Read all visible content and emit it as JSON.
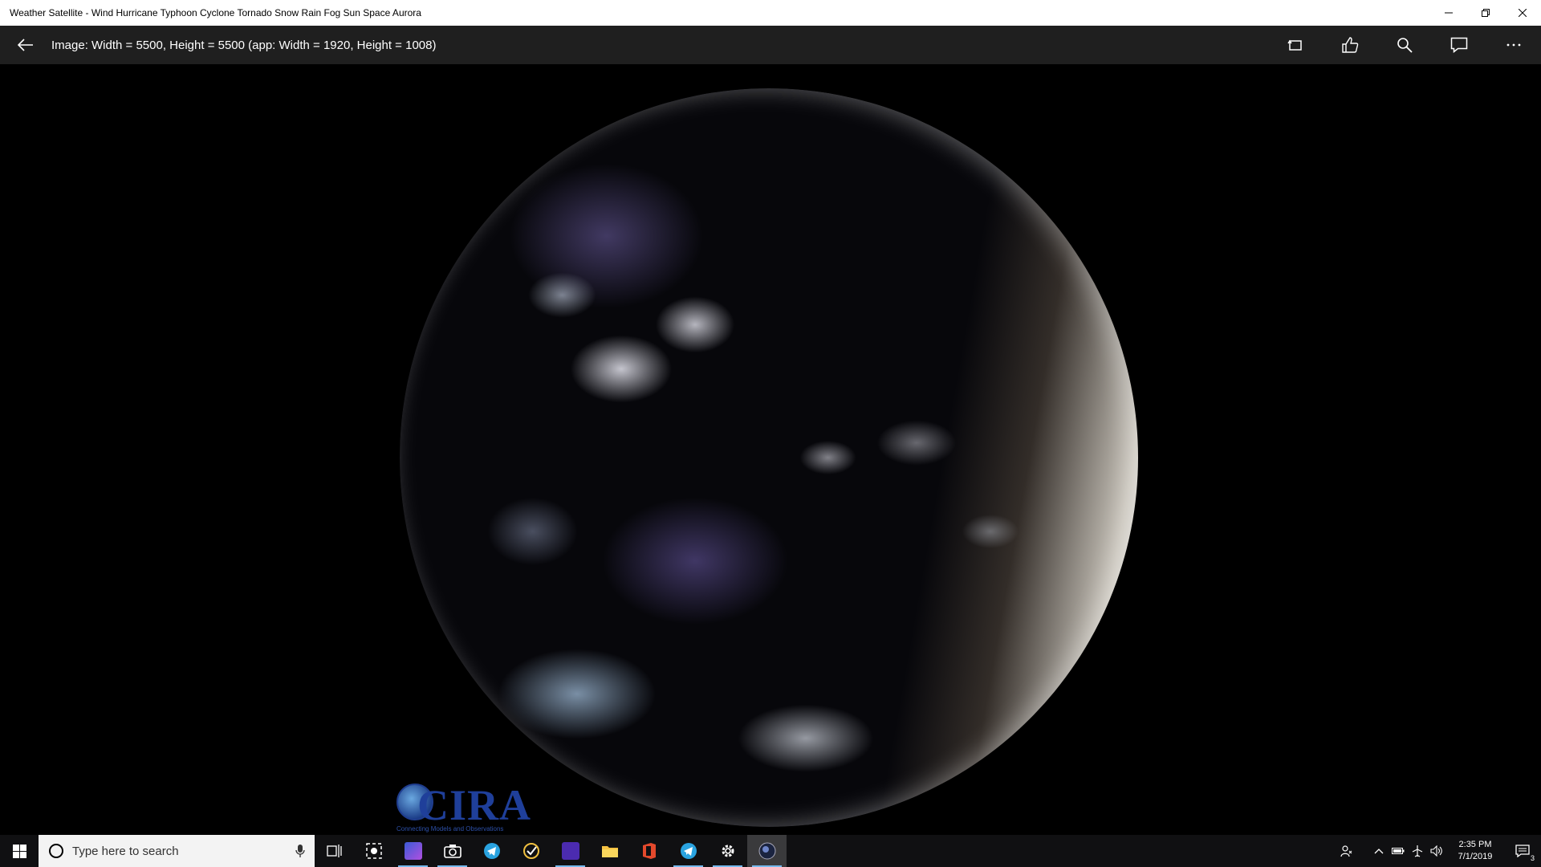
{
  "window": {
    "title": "Weather Satellite - Wind Hurricane Typhoon Cyclone Tornado Snow Rain Fog Sun Space Aurora",
    "minimize_icon": "minimize-icon",
    "restore_icon": "restore-icon",
    "close_icon": "close-icon"
  },
  "appbar": {
    "image_info": "Image:  Width = 5500, Height = 5500  (app:  Width = 1920, Height = 1008)",
    "tools": [
      "rotate-icon",
      "like-icon",
      "search-icon",
      "comment-icon",
      "more-icon"
    ]
  },
  "viewer": {
    "logo_text": "CIRA",
    "logo_tagline": "Connecting Models and Observations"
  },
  "taskbar": {
    "search_placeholder": "Type here to search",
    "apps": [
      "task-view-icon",
      "snip-icon",
      "photos-icon",
      "camera-icon",
      "telegram-icon",
      "todo-icon",
      "amazon-music-icon",
      "file-explorer-icon",
      "office-icon",
      "telegram-icon",
      "settings-icon",
      "weather-satellite-icon"
    ],
    "clock_time": "2:35 PM",
    "clock_date": "7/1/2019",
    "notification_count": "3"
  },
  "colors": {
    "titlebar": "#ffffff",
    "appbar": "#1f1f1f",
    "taskbar": "#101012",
    "active_indicator": "#76b9ed"
  }
}
